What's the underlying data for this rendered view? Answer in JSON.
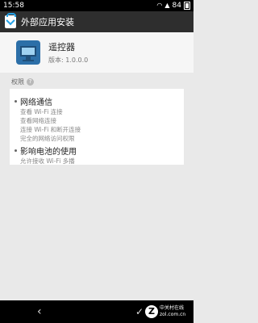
{
  "status_bar": {
    "time": "15:58",
    "battery_level": "84"
  },
  "header": {
    "title": "外部应用安装"
  },
  "app": {
    "name": "遥控器",
    "version": "版本: 1.0.0.0"
  },
  "permissions": {
    "section_label": "权限",
    "groups": [
      {
        "title": "网络通信",
        "items": [
          "查看 Wi-Fi 连接",
          "查看网络连接",
          "连接 Wi-Fi 和断开连接",
          "完全的网络访问权限"
        ]
      },
      {
        "title": "影响电池的使用",
        "items": [
          "允许接收 Wi-Fi 多播"
        ]
      }
    ]
  },
  "watermark": {
    "brand_cn": "中关村在线",
    "brand_domain": "zol.com.cn"
  }
}
